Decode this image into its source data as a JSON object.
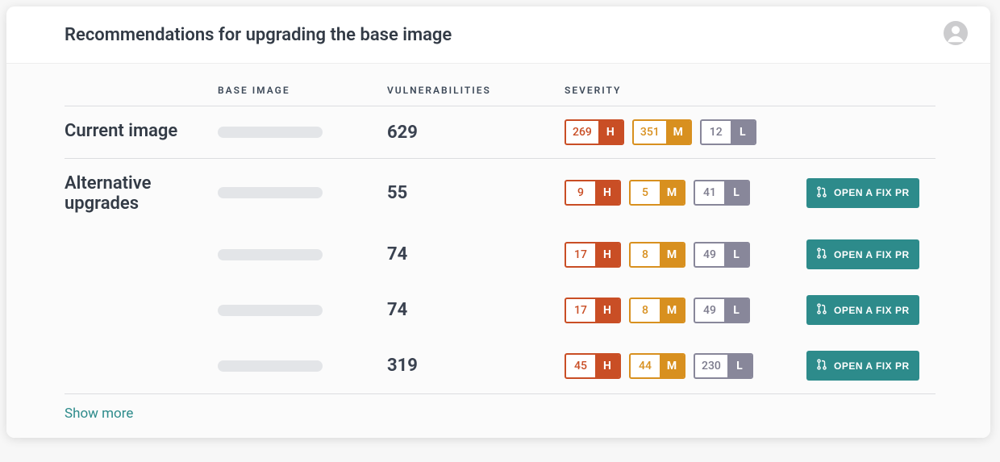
{
  "header": {
    "title": "Recommendations for upgrading the base image"
  },
  "columns": {
    "base_image": "BASE IMAGE",
    "vulnerabilities": "VULNERABILITIES",
    "severity": "SEVERITY"
  },
  "rows": [
    {
      "section_label": "Current image",
      "vuln_total": "629",
      "severity": {
        "high": "269",
        "medium": "351",
        "low": "12"
      },
      "fix_button": null
    },
    {
      "section_label": "Alternative upgrades",
      "vuln_total": "55",
      "severity": {
        "high": "9",
        "medium": "5",
        "low": "41"
      },
      "fix_button": "OPEN A FIX PR"
    },
    {
      "section_label": "",
      "vuln_total": "74",
      "severity": {
        "high": "17",
        "medium": "8",
        "low": "49"
      },
      "fix_button": "OPEN A FIX PR"
    },
    {
      "section_label": "",
      "vuln_total": "74",
      "severity": {
        "high": "17",
        "medium": "8",
        "low": "49"
      },
      "fix_button": "OPEN A FIX PR"
    },
    {
      "section_label": "",
      "vuln_total": "319",
      "severity": {
        "high": "45",
        "medium": "44",
        "low": "230"
      },
      "fix_button": "OPEN A FIX PR"
    }
  ],
  "severity_labels": {
    "high": "H",
    "medium": "M",
    "low": "L"
  },
  "show_more": "Show more",
  "colors": {
    "high": "#c94e25",
    "medium": "#d8901f",
    "low": "#88879a",
    "accent": "#2d8b8b"
  }
}
